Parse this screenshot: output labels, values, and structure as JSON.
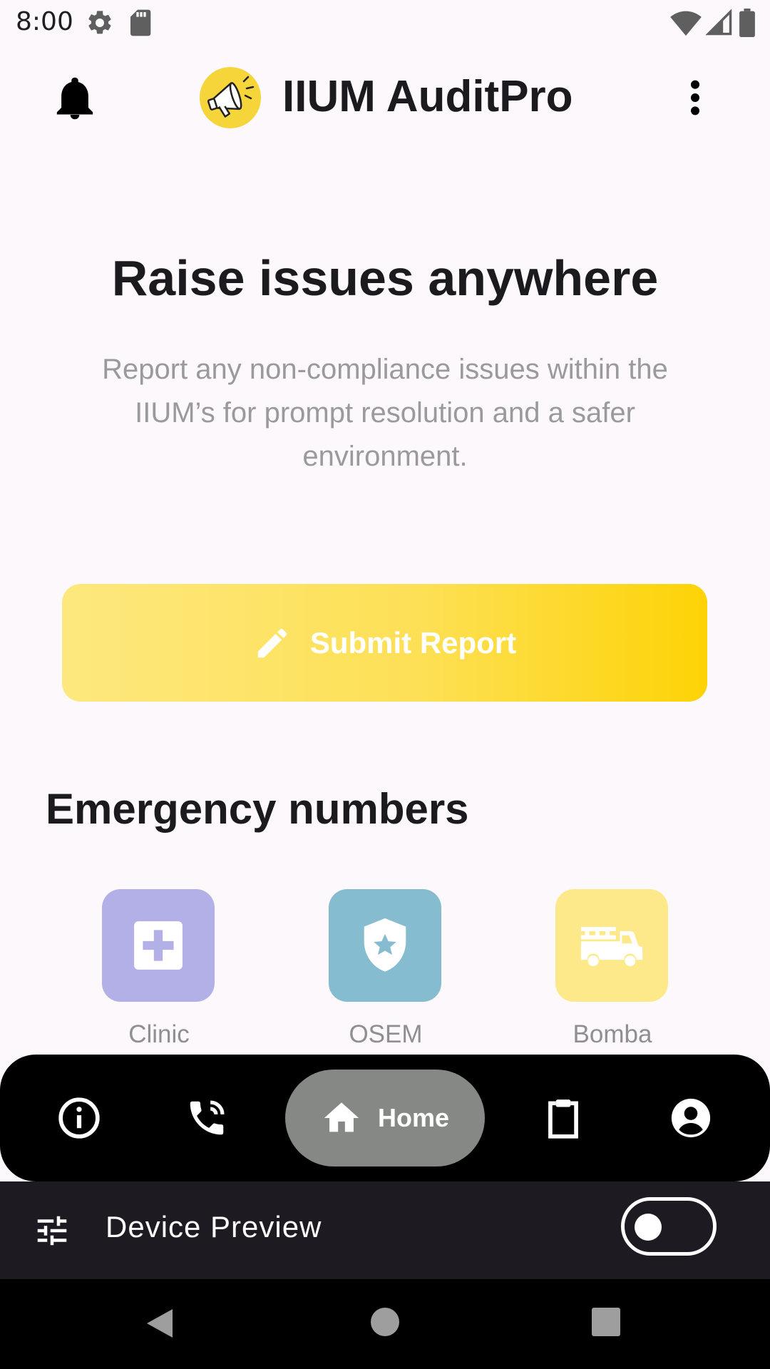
{
  "status_bar": {
    "time": "8:00",
    "icons": [
      "settings-icon",
      "sd-card-icon",
      "wifi-icon",
      "signal-icon",
      "battery-icon"
    ]
  },
  "app_bar": {
    "title": "IIUM AuditPro",
    "leading_icon": "bell-icon",
    "logo_icon": "megaphone-icon",
    "trailing_icon": "more-vert-icon"
  },
  "hero": {
    "headline": "Raise issues anywhere",
    "subtext": "Report any non-compliance issues within the IIUM’s for prompt resolution and a safer environment."
  },
  "submit_button": {
    "label": "Submit Report",
    "icon": "pencil-icon"
  },
  "emergency": {
    "title": "Emergency numbers",
    "contacts": [
      {
        "label": "Clinic",
        "icon": "medical-cross-icon",
        "color": "#b3b0e8"
      },
      {
        "label": "OSEM",
        "icon": "shield-star-icon",
        "color": "#85bccf"
      },
      {
        "label": "Bomba",
        "icon": "fire-truck-icon",
        "color": "#fde98a"
      }
    ]
  },
  "bottom_nav": {
    "items": [
      {
        "icon": "info-icon"
      },
      {
        "icon": "phone-call-icon"
      },
      {
        "icon": "home-icon",
        "label": "Home",
        "selected": true
      },
      {
        "icon": "clipboard-icon"
      },
      {
        "icon": "account-icon"
      }
    ]
  },
  "device_preview": {
    "label": "Device Preview",
    "icon": "tune-icon",
    "toggle_on": false
  },
  "system_nav": {
    "buttons": [
      "back-icon",
      "home-circle-icon",
      "recents-icon"
    ]
  },
  "colors": {
    "accent_yellow": "#fdd306",
    "background": "#fdf8fc",
    "nav_background": "#000000",
    "nav_selected": "#868886"
  }
}
